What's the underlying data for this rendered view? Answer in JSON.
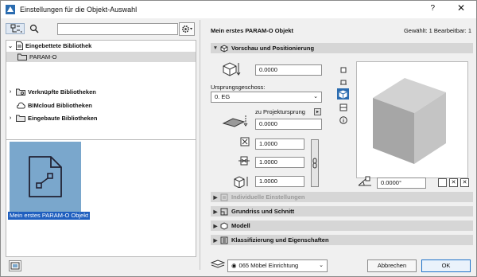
{
  "window": {
    "title": "Einstellungen für die Objekt-Auswahl",
    "help": "?",
    "close": "✕"
  },
  "left": {
    "tree": [
      {
        "label": "Eingebettete Bibliothek",
        "expanded": true,
        "highlighted": true
      },
      {
        "label": "PARAM-O",
        "child": true
      },
      {
        "label": "Verknüpfte Bibliotheken"
      },
      {
        "label": "BIMcloud Bibliotheken"
      },
      {
        "label": "Eingebaute Bibliotheken"
      }
    ],
    "search_placeholder": "",
    "selected_object_caption": "Mein erstes PARAM-O Objekt"
  },
  "right": {
    "object_name": "Mein erstes PARAM-O Objekt",
    "selection_info": "Gewählt: 1 Bearbeitbar: 1",
    "sections": {
      "vorschau": "Vorschau und Positionierung",
      "individuell": "Individuelle Einstellungen",
      "grundriss": "Grundriss und Schnitt",
      "modell": "Modell",
      "klassifizierung": "Klassifizierung und Eigenschaften"
    },
    "elevation_value": "0.0000",
    "home_story_label": "Ursprungsgeschoss:",
    "home_story_value": "0. EG",
    "project_origin_label": "zu Projektursprung",
    "project_origin_value": "0.0000",
    "dim_x": "1.0000",
    "dim_y": "1.0000",
    "dim_z": "1.0000",
    "rotation": "0.0000°"
  },
  "footer": {
    "layer": "065 Möbel Einrichtung",
    "cancel": "Abbrechen",
    "ok": "OK"
  },
  "colors": {
    "accent": "#1f5fbf",
    "thumb": "#7aa7cc",
    "section": "#d6d6d6"
  }
}
